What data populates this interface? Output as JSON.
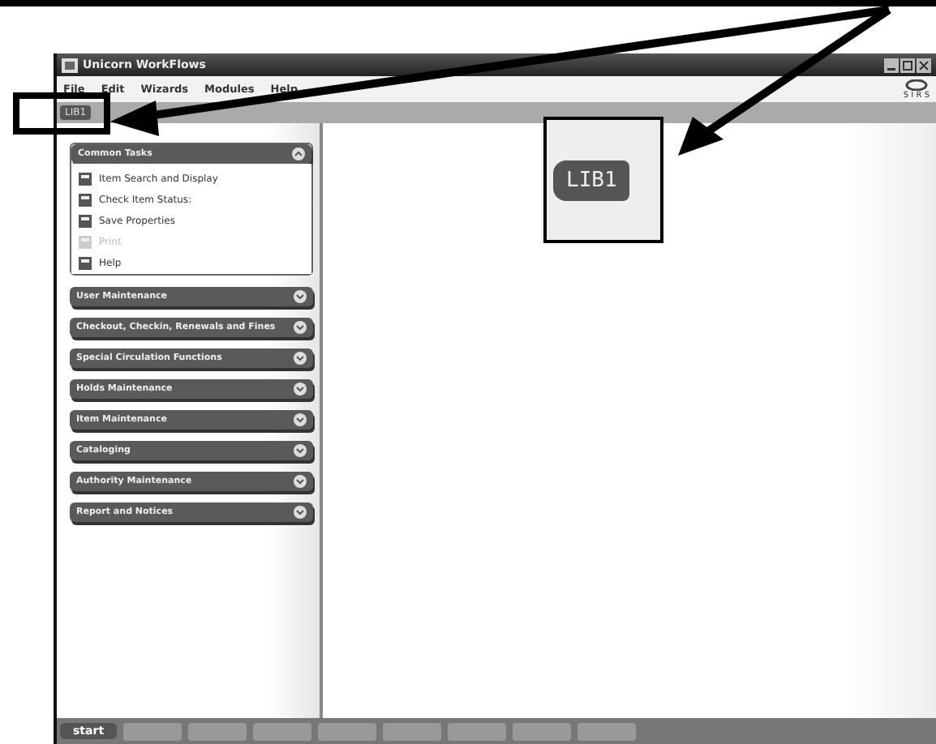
{
  "window": {
    "title": "Unicorn WorkFlows",
    "logo": "S I R S"
  },
  "menu": [
    "File",
    "Edit",
    "Wizards",
    "Modules",
    "Help"
  ],
  "tabs": [
    {
      "label": "LIB1",
      "selected": true
    }
  ],
  "common_tasks": {
    "title": "Common Tasks",
    "expanded": true,
    "items": [
      {
        "label": "Item Search and Display",
        "disabled": false
      },
      {
        "label": "Check Item Status:",
        "disabled": false
      },
      {
        "label": "Save Properties",
        "disabled": false
      },
      {
        "label": "Print",
        "disabled": true
      },
      {
        "label": "Help",
        "disabled": false
      }
    ]
  },
  "groups": [
    {
      "title": "User Maintenance",
      "expanded": false
    },
    {
      "title": "Checkout, Checkin, Renewals and Fines",
      "expanded": false
    },
    {
      "title": "Special Circulation Functions",
      "expanded": false
    },
    {
      "title": "Holds Maintenance",
      "expanded": false
    },
    {
      "title": "Item Maintenance",
      "expanded": false
    },
    {
      "title": "Cataloging",
      "expanded": false
    },
    {
      "title": "Authority Maintenance",
      "expanded": false
    },
    {
      "title": "Report and Notices",
      "expanded": false
    }
  ],
  "taskbar": {
    "start": "start"
  },
  "callout": {
    "label": "LIB1"
  }
}
